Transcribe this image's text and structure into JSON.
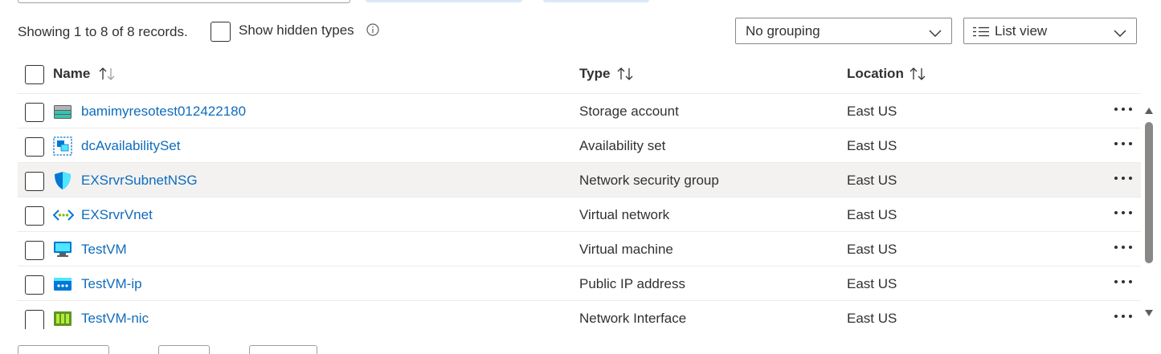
{
  "toolbar": {
    "records_text": "Showing 1 to 8 of 8 records.",
    "show_hidden_label": "Show hidden types",
    "grouping_value": "No grouping",
    "view_value": "List view"
  },
  "columns": {
    "name": "Name",
    "type": "Type",
    "location": "Location"
  },
  "rows": [
    {
      "name": "bamimyresotest012422180",
      "type": "Storage account",
      "location": "East US",
      "icon": "storage-account-icon"
    },
    {
      "name": "dcAvailabilitySet",
      "type": "Availability set",
      "location": "East US",
      "icon": "availability-set-icon"
    },
    {
      "name": "EXSrvrSubnetNSG",
      "type": "Network security group",
      "location": "East US",
      "icon": "network-security-group-icon"
    },
    {
      "name": "EXSrvrVnet",
      "type": "Virtual network",
      "location": "East US",
      "icon": "virtual-network-icon"
    },
    {
      "name": "TestVM",
      "type": "Virtual machine",
      "location": "East US",
      "icon": "virtual-machine-icon"
    },
    {
      "name": "TestVM-ip",
      "type": "Public IP address",
      "location": "East US",
      "icon": "public-ip-icon"
    },
    {
      "name": "TestVM-nic",
      "type": "Network Interface",
      "location": "East US",
      "icon": "network-interface-icon"
    }
  ],
  "colors": {
    "link": "#0f6cbd",
    "text": "#323130",
    "hover_row": "#f3f2f1"
  }
}
